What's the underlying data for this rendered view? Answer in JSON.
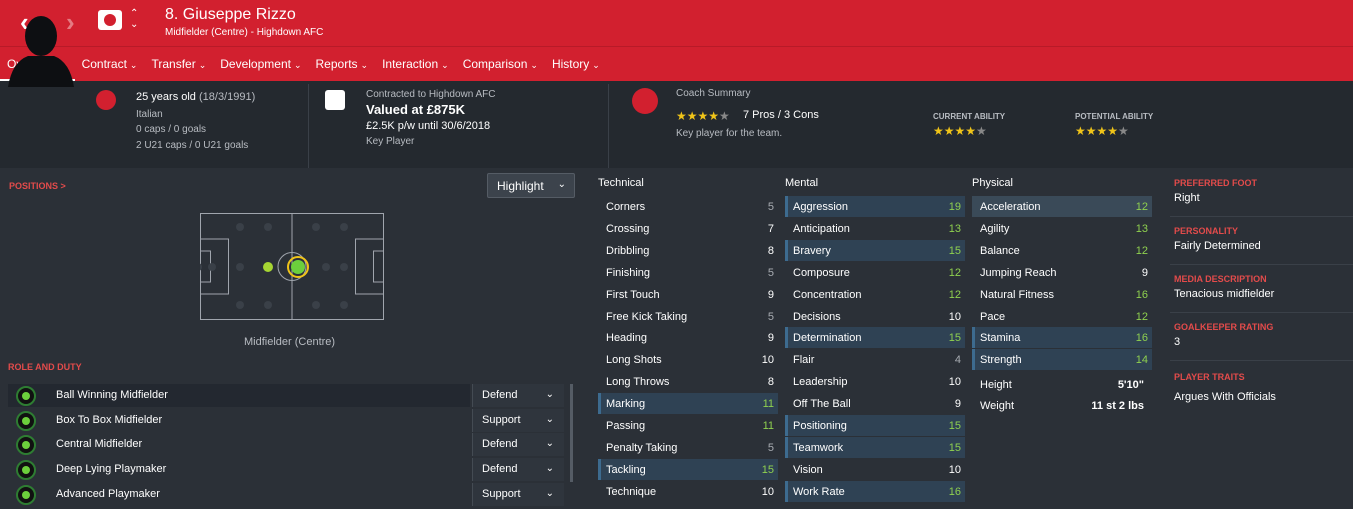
{
  "header": {
    "title": "8. Giuseppe Rizzo",
    "subtitle": "Midfielder (Centre) - Highdown AFC",
    "back_icon": "chevron-left-icon",
    "forward_icon": "chevron-right-icon"
  },
  "tabs": [
    {
      "label": "Overview"
    },
    {
      "label": "Contract"
    },
    {
      "label": "Transfer"
    },
    {
      "label": "Development"
    },
    {
      "label": "Reports"
    },
    {
      "label": "Interaction"
    },
    {
      "label": "Comparison"
    },
    {
      "label": "History"
    }
  ],
  "info": {
    "age_line": "25 years old",
    "dob": "(18/3/1991)",
    "nationality": "Italian",
    "caps": "0 caps / 0 goals",
    "u21_caps": "2 U21 caps / 0 U21 goals",
    "contract_label": "Contracted to Highdown AFC",
    "value": "Valued at £875K",
    "wage": "£2.5K p/w until 30/6/2018",
    "status": "Key Player",
    "coach_label": "Coach Summary",
    "pros_cons": "7 Pros / 3 Cons",
    "coach_note": "Key player for the team.",
    "coach_stars": 4,
    "current_ability_label": "CURRENT ABILITY",
    "potential_ability_label": "POTENTIAL ABILITY",
    "current_stars": 4,
    "potential_stars": 4
  },
  "positions": {
    "label": "POSITIONS >",
    "highlight": "Highlight",
    "position_name": "Midfielder (Centre)"
  },
  "roles": {
    "label": "ROLE AND DUTY",
    "items": [
      {
        "name": "Ball Winning Midfielder",
        "duty": "Defend"
      },
      {
        "name": "Box To Box Midfielder",
        "duty": "Support"
      },
      {
        "name": "Central Midfielder",
        "duty": "Defend"
      },
      {
        "name": "Deep Lying Playmaker",
        "duty": "Defend"
      },
      {
        "name": "Advanced Playmaker",
        "duty": "Support"
      }
    ]
  },
  "technical": {
    "title": "Technical",
    "items": [
      {
        "name": "Corners",
        "value": "5"
      },
      {
        "name": "Crossing",
        "value": "7"
      },
      {
        "name": "Dribbling",
        "value": "8"
      },
      {
        "name": "Finishing",
        "value": "5"
      },
      {
        "name": "First Touch",
        "value": "9"
      },
      {
        "name": "Free Kick Taking",
        "value": "5"
      },
      {
        "name": "Heading",
        "value": "9"
      },
      {
        "name": "Long Shots",
        "value": "10"
      },
      {
        "name": "Long Throws",
        "value": "8"
      },
      {
        "name": "Marking",
        "value": "11"
      },
      {
        "name": "Passing",
        "value": "11"
      },
      {
        "name": "Penalty Taking",
        "value": "5"
      },
      {
        "name": "Tackling",
        "value": "15"
      },
      {
        "name": "Technique",
        "value": "10"
      }
    ]
  },
  "mental": {
    "title": "Mental",
    "items": [
      {
        "name": "Aggression",
        "value": "19"
      },
      {
        "name": "Anticipation",
        "value": "13"
      },
      {
        "name": "Bravery",
        "value": "15"
      },
      {
        "name": "Composure",
        "value": "12"
      },
      {
        "name": "Concentration",
        "value": "12"
      },
      {
        "name": "Decisions",
        "value": "10"
      },
      {
        "name": "Determination",
        "value": "15"
      },
      {
        "name": "Flair",
        "value": "4"
      },
      {
        "name": "Leadership",
        "value": "10"
      },
      {
        "name": "Off The Ball",
        "value": "9"
      },
      {
        "name": "Positioning",
        "value": "15"
      },
      {
        "name": "Teamwork",
        "value": "15"
      },
      {
        "name": "Vision",
        "value": "10"
      },
      {
        "name": "Work Rate",
        "value": "16"
      }
    ]
  },
  "physical": {
    "title": "Physical",
    "items": [
      {
        "name": "Acceleration",
        "value": "12"
      },
      {
        "name": "Agility",
        "value": "13"
      },
      {
        "name": "Balance",
        "value": "12"
      },
      {
        "name": "Jumping Reach",
        "value": "9"
      },
      {
        "name": "Natural Fitness",
        "value": "16"
      },
      {
        "name": "Pace",
        "value": "12"
      },
      {
        "name": "Stamina",
        "value": "16"
      },
      {
        "name": "Strength",
        "value": "14"
      }
    ],
    "height_label": "Height",
    "height": "5'10\"",
    "weight_label": "Weight",
    "weight": "11 st 2 lbs"
  },
  "sidebar": {
    "preferred_foot_label": "PREFERRED FOOT",
    "preferred_foot": "Right",
    "personality_label": "PERSONALITY",
    "personality": "Fairly Determined",
    "media_label": "MEDIA DESCRIPTION",
    "media": "Tenacious midfielder",
    "gk_label": "GOALKEEPER RATING",
    "gk": "3",
    "traits_label": "PLAYER TRAITS",
    "traits": "Argues With Officials"
  },
  "colors": {
    "header": "#d2202f",
    "background": "#2b3037",
    "green_value": "#8fd14f",
    "star": "#f0c419"
  }
}
